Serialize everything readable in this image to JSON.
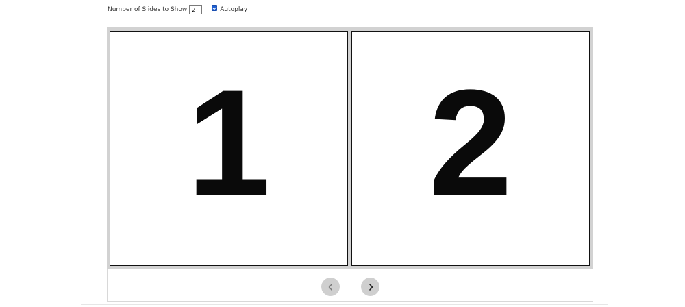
{
  "controls": {
    "slides_to_show_label": "Number of Slides to Show",
    "slides_to_show_value": "2",
    "autoplay_label": "Autoplay",
    "autoplay_checked": true
  },
  "carousel": {
    "slides": [
      {
        "label": "1"
      },
      {
        "label": "2"
      }
    ],
    "prev_icon": "chevron-left-icon",
    "next_icon": "chevron-right-icon"
  },
  "colors": {
    "frame": "#d2d2d2",
    "nav_button": "#cfcfcf",
    "checkbox": "#1f5fd1"
  }
}
